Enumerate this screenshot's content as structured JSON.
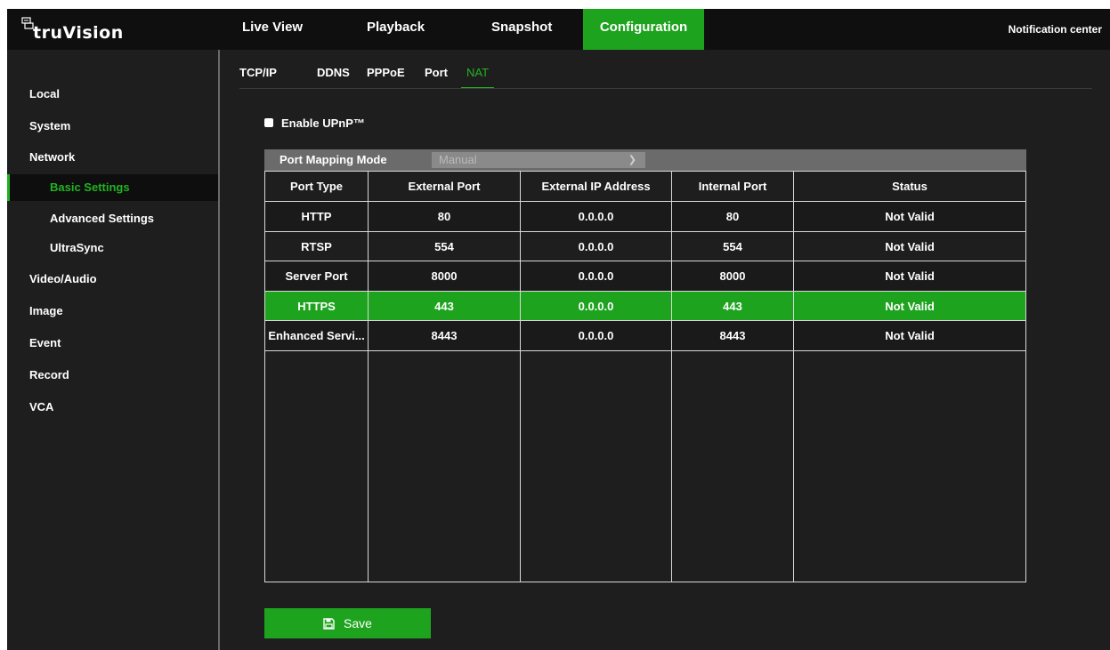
{
  "app": {
    "logo_text": "truVision",
    "nav_tabs": [
      "Live View",
      "Playback",
      "Snapshot",
      "Configuration"
    ],
    "active_tab": "Configuration",
    "notification_label": "Notification center",
    "accent_color": "#1ea31e"
  },
  "sidebar": {
    "items": [
      "Local",
      "System",
      "Network",
      "Basic Settings",
      "Advanced Settings",
      "UltraSync",
      "Video/Audio",
      "Image",
      "Event",
      "Record",
      "VCA"
    ],
    "active_item": "Basic Settings"
  },
  "subtabs": {
    "items": [
      "TCP/IP",
      "DDNS",
      "PPPoE",
      "Port",
      "NAT"
    ],
    "active": "NAT"
  },
  "upnp": {
    "label": "Enable UPnP™",
    "checked": false
  },
  "mapping": {
    "label": "Port Mapping Mode",
    "value": "Manual"
  },
  "table": {
    "headers": [
      "Port Type",
      "External Port",
      "External IP Address",
      "Internal Port",
      "Status"
    ],
    "rows": [
      [
        "HTTP",
        "80",
        "0.0.0.0",
        "80",
        "Not Valid"
      ],
      [
        "RTSP",
        "554",
        "0.0.0.0",
        "554",
        "Not Valid"
      ],
      [
        "Server Port",
        "8000",
        "0.0.0.0",
        "8000",
        "Not Valid"
      ],
      [
        "HTTPS",
        "443",
        "0.0.0.0",
        "443",
        "Not Valid"
      ],
      [
        "Enhanced Servi...",
        "8443",
        "0.0.0.0",
        "8443",
        "Not Valid"
      ]
    ],
    "selected_row_label": "HTTPS"
  },
  "save_button": {
    "label": "Save"
  }
}
